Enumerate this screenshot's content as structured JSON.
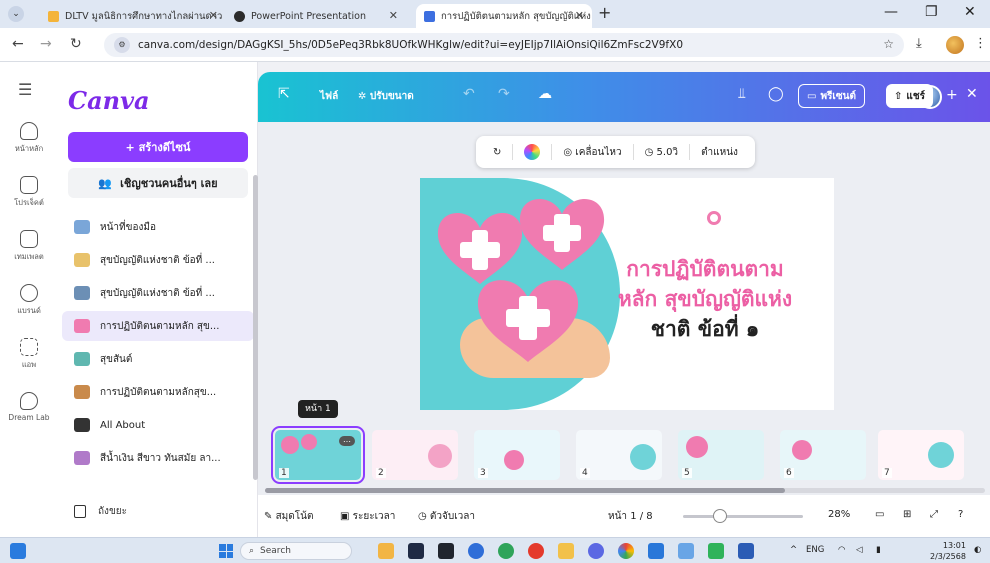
{
  "browser": {
    "tabs": [
      {
        "label": "DLTV มูลนิธิการศึกษาทางไกลผ่านดาว",
        "close": "✕",
        "color": "#f4b43a"
      },
      {
        "label": "PowerPoint Presentation",
        "close": "",
        "color": "#2b2b2b"
      },
      {
        "label": "การปฏิบัติตนตามหลัก สุขบัญญัติแห่ง",
        "close": "✕",
        "color": "#3d6fe0"
      }
    ],
    "new_tab": "+",
    "window_controls": {
      "minimize": "—",
      "maximize": "❐",
      "close": "✕"
    },
    "url": "canva.com/design/DAGgKSI_5hs/0D5ePeq3Rbk8UOfkWHKglw/edit?ui=eyJEIjp7IlAiOnsiQil6ZmFsc2V9fX0"
  },
  "canva": {
    "rail": [
      {
        "label": "หน้าหลัก",
        "icon": "home-icon"
      },
      {
        "label": "โปรเจ็คต์",
        "icon": "folder-icon"
      },
      {
        "label": "เทมเพลต",
        "icon": "template-icon"
      },
      {
        "label": "แบรนด์",
        "icon": "brand-icon"
      },
      {
        "label": "แอพ",
        "icon": "apps-icon"
      },
      {
        "label": "Dream Lab",
        "icon": "dream-lab-icon"
      }
    ],
    "logo": "Canva",
    "create_button": "+ สร้างดีไซน์",
    "invite_button": "เชิญชวนคนอื่นๆ เลย",
    "recent": [
      {
        "label": "หน้าที่ของมือ",
        "color": "#7aa6d8"
      },
      {
        "label": "สุขบัญญัติแห่งชาติ ข้อที่ ...",
        "color": "#e8c26b"
      },
      {
        "label": "สุขบัญญัติแห่งชาติ ข้อที่ ...",
        "color": "#6c8fb5"
      },
      {
        "label": "การปฏิบัติตนตามหลัก สุข...",
        "color": "#f07bb0"
      },
      {
        "label": "สุขสันต์",
        "color": "#5fb7b0"
      },
      {
        "label": "การปฏิบัติตนตามหลักสุข...",
        "color": "#c98a4b"
      },
      {
        "label": "All About",
        "color": "#333333"
      },
      {
        "label": "สีน้ำเงิน สีขาว ทันสมัย ลา...",
        "color": "#b07ac9"
      }
    ],
    "trash": "ถังขยะ",
    "topbar": {
      "file": "ไฟล์",
      "resize": "ปรับขนาด",
      "present": "พรีเซนต์",
      "share": "แชร์"
    },
    "floating_toolbar": {
      "animate": "เคลื่อนไหว",
      "duration": "5.0วิ",
      "position": "ตำแหน่ง"
    },
    "slide": {
      "title_line1": "การปฏิบัติตนตาม",
      "title_line2": "หลัก สุขบัญญัติแห่ง",
      "title_line3": "ชาติ ข้อที่ ๑"
    },
    "page_tooltip": "หน้า 1",
    "thumbnails": [
      "1",
      "2",
      "3",
      "4",
      "5",
      "6",
      "7"
    ],
    "bottombar": {
      "notes": "สมุดโน้ต",
      "timeline": "ระยะเวลา",
      "timer": "ตัวจับเวลา",
      "page": "หน้า 1 / 8",
      "zoom": "28%"
    }
  },
  "taskbar": {
    "search": "Search",
    "lang": "ENG",
    "time": "13:01",
    "date": "2/3/2568"
  }
}
